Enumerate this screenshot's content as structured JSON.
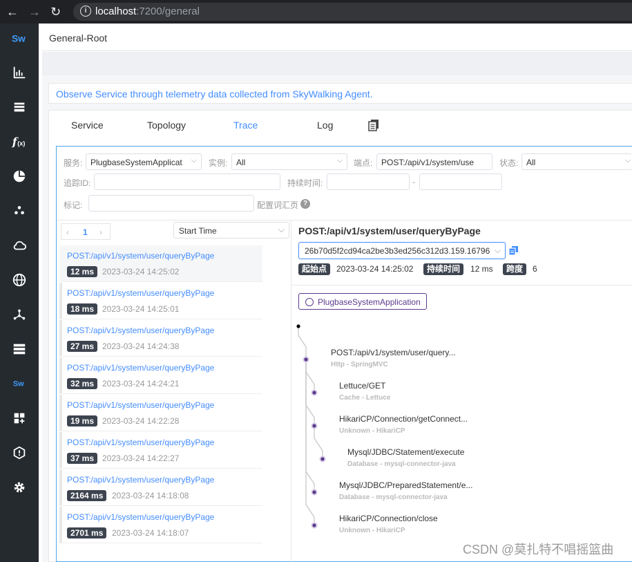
{
  "browser": {
    "url_host": "localhost",
    "url_path": ":7200/general"
  },
  "header": {
    "title": "General-Root"
  },
  "notice": "Observe Service through telemetry data collected from SkyWalking Agent.",
  "tabs": [
    {
      "label": "Service"
    },
    {
      "label": "Topology"
    },
    {
      "label": "Trace"
    },
    {
      "label": "Log"
    }
  ],
  "filters": {
    "service_label": "服务:",
    "service_value": "PlugbaseSystemApplicat",
    "instance_label": "实例:",
    "instance_value": "All",
    "endpoint_label": "端点:",
    "endpoint_value": "POST:/api/v1/system/use",
    "status_label": "状态:",
    "status_value": "All",
    "trace_id_label": "追踪ID:",
    "duration_label": "持续时间:",
    "duration_sep": "-",
    "tag_label": "标记:",
    "tag_help": "配置词汇页"
  },
  "pager": {
    "page": "1",
    "prev": "‹",
    "next": "›"
  },
  "sort": {
    "value": "Start Time"
  },
  "traces": [
    {
      "endpoint": "POST:/api/v1/system/user/queryByPage",
      "duration": "12 ms",
      "time": "2023-03-24 14:25:02"
    },
    {
      "endpoint": "POST:/api/v1/system/user/queryByPage",
      "duration": "18 ms",
      "time": "2023-03-24 14:25:01"
    },
    {
      "endpoint": "POST:/api/v1/system/user/queryByPage",
      "duration": "27 ms",
      "time": "2023-03-24 14:24:38"
    },
    {
      "endpoint": "POST:/api/v1/system/user/queryByPage",
      "duration": "32 ms",
      "time": "2023-03-24 14:24:21"
    },
    {
      "endpoint": "POST:/api/v1/system/user/queryByPage",
      "duration": "19 ms",
      "time": "2023-03-24 14:22:28"
    },
    {
      "endpoint": "POST:/api/v1/system/user/queryByPage",
      "duration": "37 ms",
      "time": "2023-03-24 14:22:27"
    },
    {
      "endpoint": "POST:/api/v1/system/user/queryByPage",
      "duration": "2164 ms",
      "time": "2023-03-24 14:18:08"
    },
    {
      "endpoint": "POST:/api/v1/system/user/queryByPage",
      "duration": "2701 ms",
      "time": "2023-03-24 14:18:07"
    }
  ],
  "detail": {
    "title": "POST:/api/v1/system/user/queryByPage",
    "trace_id": "26b70d5f2cd94ca2be3b3ed256c312d3.159.16796",
    "start_label": "起始点",
    "start_value": "2023-03-24 14:25:02",
    "duration_label": "持续时间",
    "duration_value": "12 ms",
    "spans_label": "跨度",
    "spans_value": "6",
    "service": "PlugbaseSystemApplication"
  },
  "spans": [
    {
      "name": "POST:/api/v1/system/user/query...",
      "sub": "Http - SpringMVC"
    },
    {
      "name": "Lettuce/GET",
      "sub": "Cache - Lettuce"
    },
    {
      "name": "HikariCP/Connection/getConnect...",
      "sub": "Unknown - HikariCP"
    },
    {
      "name": "Mysql/JDBC/Statement/execute",
      "sub": "Database - mysql-connector-java"
    },
    {
      "name": "Mysql/JDBC/PreparedStatement/e...",
      "sub": "Database - mysql-connector-java"
    },
    {
      "name": "HikariCP/Connection/close",
      "sub": "Unknown - HikariCP"
    }
  ],
  "watermark": "CSDN @莫扎特不唱摇篮曲",
  "colors": {
    "accent": "#448dfe",
    "sidebar": "#252a2f",
    "span_node": "#5b3a8c"
  }
}
